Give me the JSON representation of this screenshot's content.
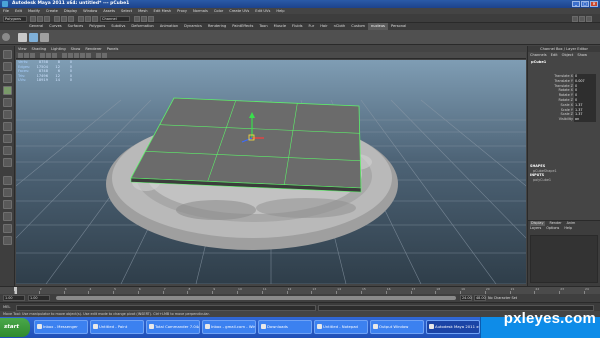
{
  "window": {
    "title": "Autodesk Maya 2011 x64: untitled*   ---   pCube1"
  },
  "menubar": {
    "items": [
      "File",
      "Edit",
      "Modify",
      "Create",
      "Display",
      "Window",
      "Assets",
      "Select",
      "Mesh",
      "Edit Mesh",
      "Proxy",
      "Normals",
      "Color",
      "Create UVs",
      "Edit UVs",
      "Help"
    ]
  },
  "statusline": {
    "mode": "Polygons",
    "name_field": "Channel"
  },
  "shelf": {
    "tabs": [
      "General",
      "Curves",
      "Surfaces",
      "Polygons",
      "Subdivs",
      "Deformation",
      "Animation",
      "Dynamics",
      "Rendering",
      "PaintEffects",
      "Toon",
      "Muscle",
      "Fluids",
      "Fur",
      "Hair",
      "nCloth",
      "Custom",
      "nucleus",
      "Personal"
    ],
    "active_tab": "nucleus"
  },
  "panel": {
    "menu": [
      "View",
      "Shading",
      "Lighting",
      "Show",
      "Renderer",
      "Panels"
    ]
  },
  "hud": {
    "rows": [
      {
        "label": "Verts:",
        "a": "8758",
        "b": "8",
        "c": "0"
      },
      {
        "label": "Edges:",
        "a": "17504",
        "b": "12",
        "c": "0"
      },
      {
        "label": "Faces:",
        "a": "8748",
        "b": "6",
        "c": "0"
      },
      {
        "label": "Tris:",
        "a": "17496",
        "b": "12",
        "c": "0"
      },
      {
        "label": "UVs:",
        "a": "18919",
        "b": "14",
        "c": "0"
      }
    ]
  },
  "channel_box": {
    "title": "Channel Box / Layer Editor",
    "tabs": [
      "Channels",
      "Edit",
      "Object",
      "Show"
    ],
    "object_name": "pCube1",
    "attributes": [
      {
        "name": "Translate X",
        "value": "0"
      },
      {
        "name": "Translate Y",
        "value": "0.007"
      },
      {
        "name": "Translate Z",
        "value": "0"
      },
      {
        "name": "Rotate X",
        "value": "0"
      },
      {
        "name": "Rotate Y",
        "value": "0"
      },
      {
        "name": "Rotate Z",
        "value": "0"
      },
      {
        "name": "Scale X",
        "value": "1.37"
      },
      {
        "name": "Scale Y",
        "value": "1.37"
      },
      {
        "name": "Scale Z",
        "value": "1.37"
      },
      {
        "name": "Visibility",
        "value": "on"
      }
    ],
    "shapes_header": "SHAPES",
    "shape_item": "pCubeShape1",
    "inputs_header": "INPUTS",
    "input_item": "polyCube1"
  },
  "layer_editor": {
    "tabs": [
      "Display",
      "Render",
      "Anim"
    ],
    "menu": [
      "Layers",
      "Options",
      "Help"
    ]
  },
  "time": {
    "ticks": [
      "1",
      "2",
      "3",
      "4",
      "5",
      "6",
      "7",
      "8",
      "9",
      "10",
      "11",
      "12",
      "13",
      "14",
      "15",
      "16",
      "17",
      "18",
      "19",
      "20",
      "21",
      "22",
      "23",
      "24"
    ],
    "start": "1.00",
    "inner_start": "1.00",
    "inner_end": "24.00",
    "end": "48.00",
    "char_set": "No Character Set"
  },
  "command_line": {
    "label": "MEL"
  },
  "help_line": {
    "text": "Move Tool: Use manipulator to move object(s). Use edit mode to change pivot (INSERT). Ctrl+LMB to move perpendicular."
  },
  "taskbar": {
    "start_label": "start",
    "buttons": [
      "Inbox - Messenger",
      "Untitled - Paint",
      "Total Commander 7.04a",
      "Inbox - gmail.com - Windo...",
      "Downloads",
      "Untitled - Notepad",
      "Output Window",
      "Autodesk Maya 2011 x6..."
    ],
    "active_button": "Autodesk Maya 2011 x6..."
  },
  "watermark": {
    "brand": "pxleyes.com"
  },
  "colors": {
    "mesh_selected": "#5ef06a",
    "plate_fill": "#6b6b6b",
    "pizza_dough": "#b9b9b9",
    "grid_line": "#8a98a6",
    "taskbar_blue": "#2a5fc8",
    "start_green": "#3a9a3a"
  }
}
